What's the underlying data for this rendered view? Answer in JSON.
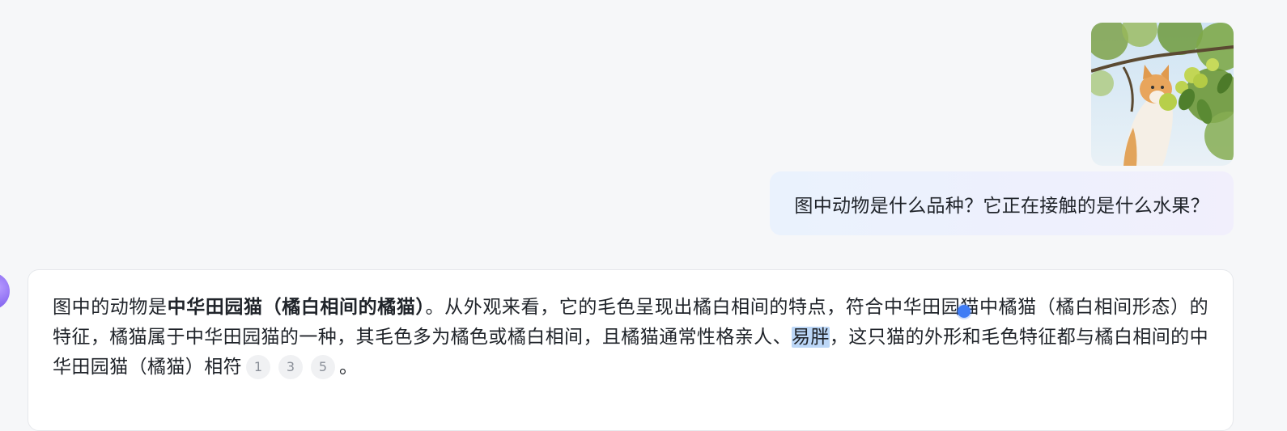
{
  "user_message": {
    "image_alt": "",
    "question": "图中动物是什么品种？它正在接触的是什么水果？"
  },
  "assistant_message": {
    "part1": "图中的动物是",
    "bold": "中华田园猫（橘白相间的橘猫）",
    "part2": "。从外观来看，它的毛色呈现出橘白相间的特点，符合中华田园猫中橘猫（橘白相间形态）的特征，橘猫属于中华田园猫的一种，其毛色多为橘色或橘白相间，且橘猫通常性格亲人、",
    "selected": "易胖",
    "part3": "，这只猫的外形和毛色特征都与橘白相间的中华田园猫（橘猫）相符",
    "citations": [
      "1",
      "3",
      "5"
    ],
    "end": "。"
  },
  "colors": {
    "background": "#f6f7f9",
    "bubble_start": "#eaf2fd",
    "bubble_end": "#f1effc",
    "selection": "#bcd7f7",
    "cursor": "#3f7cf5",
    "avatar": "#8b6cf2"
  }
}
